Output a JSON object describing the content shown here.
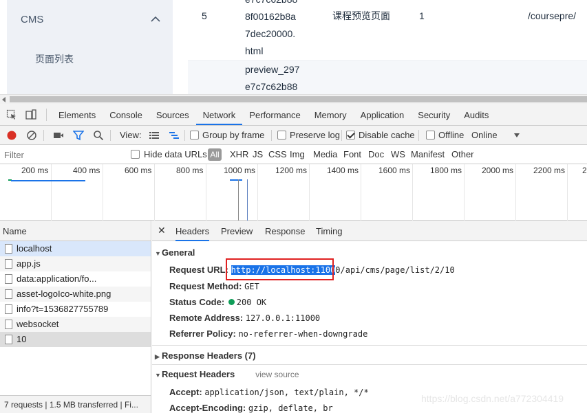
{
  "app": {
    "menu_title": "CMS",
    "menu_item": "页面列表",
    "rows": [
      {
        "index": "5",
        "name": "e7c7c62b88 8f00162b8a 7dec20000. html",
        "alias": "课程预览页面",
        "type": "1",
        "path": "/coursepre/"
      },
      {
        "name": "preview_297 e7c7c62b88"
      }
    ]
  },
  "devtools": {
    "tabs": [
      "Elements",
      "Console",
      "Sources",
      "Network",
      "Performance",
      "Memory",
      "Application",
      "Security",
      "Audits"
    ],
    "toolbar": {
      "view_label": "View:",
      "group_by_frame": "Group by frame",
      "preserve_log": "Preserve log",
      "disable_cache": "Disable cache",
      "offline": "Offline",
      "throttle": "Online"
    },
    "filter": {
      "placeholder": "Filter",
      "hide_data_urls": "Hide data URLs",
      "all": "All",
      "types": [
        "XHR",
        "JS",
        "CSS",
        "Img",
        "Media",
        "Font",
        "Doc",
        "WS",
        "Manifest",
        "Other"
      ]
    },
    "timeline_ticks": [
      "200 ms",
      "400 ms",
      "600 ms",
      "800 ms",
      "1000 ms",
      "1200 ms",
      "1400 ms",
      "1600 ms",
      "1800 ms",
      "2000 ms",
      "2200 ms",
      "2"
    ],
    "requests": {
      "header": "Name",
      "items": [
        "localhost",
        "app.js",
        "data:application/fo...",
        "asset-logoIco-white.png",
        "info?t=1536827755789",
        "websocket",
        "10"
      ],
      "status": "7 requests | 1.5 MB transferred | Fi..."
    },
    "details": {
      "tabs": [
        "Headers",
        "Preview",
        "Response",
        "Timing"
      ],
      "general_title": "General",
      "request_url_key": "Request URL:",
      "request_url_selected": "http://localhost:1100",
      "request_url_rest": "0/api/cms/page/list/2/10",
      "request_method_key": "Request Method:",
      "request_method": "GET",
      "status_code_key": "Status Code:",
      "status_code": "200 OK",
      "remote_address_key": "Remote Address:",
      "remote_address": "127.0.0.1:11000",
      "referrer_policy_key": "Referrer Policy:",
      "referrer_policy": "no-referrer-when-downgrade",
      "response_headers_title": "Response Headers (7)",
      "request_headers_title": "Request Headers",
      "view_source": "view source",
      "accept_key": "Accept:",
      "accept": "application/json, text/plain, */*",
      "accept_encoding_key": "Accept-Encoding:",
      "accept_encoding": "gzip, deflate, br"
    }
  },
  "watermark": "https://blog.csdn.net/a772304419",
  "colors": {
    "accent": "#1a73e8",
    "record": "#d93025",
    "status_ok": "#0f9d58",
    "highlight_box": "#e02020"
  }
}
